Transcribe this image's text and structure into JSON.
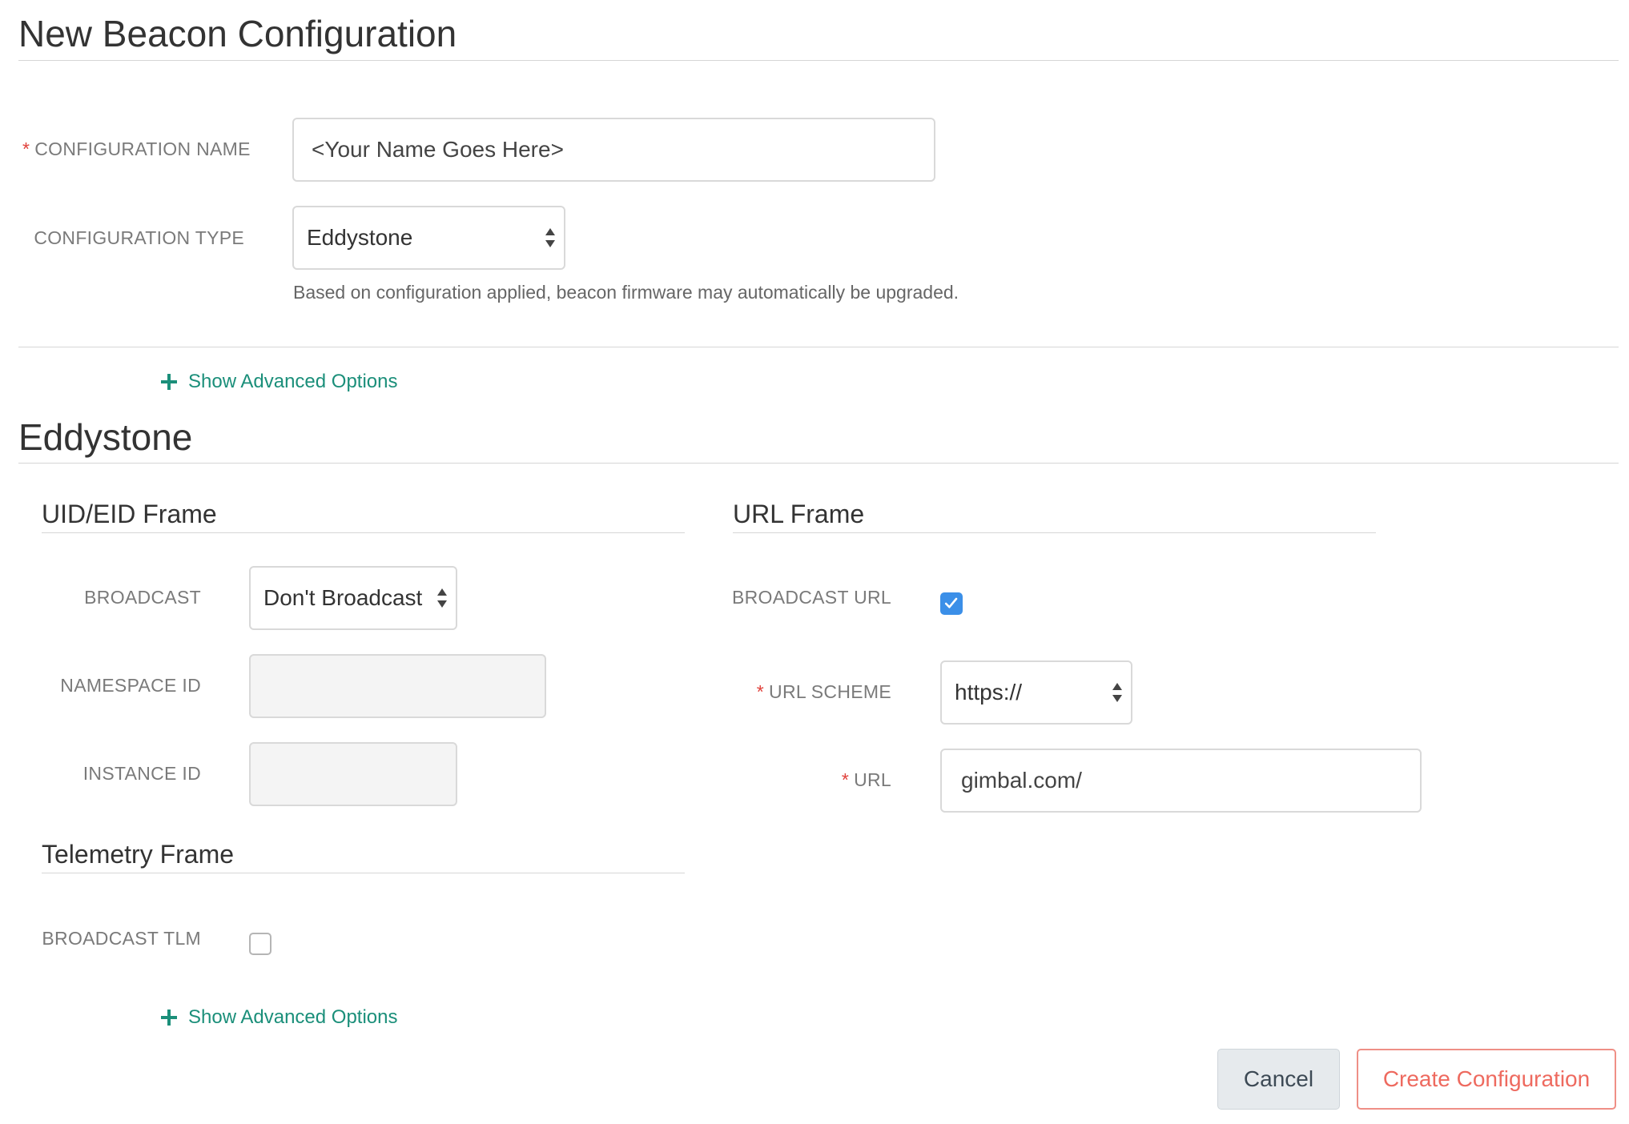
{
  "header": {
    "title": "New Beacon Configuration"
  },
  "form": {
    "required_marker": "*",
    "name_label": "CONFIGURATION NAME",
    "name_value": "<Your Name Goes Here>",
    "type_label": "CONFIGURATION TYPE",
    "type_value": "Eddystone",
    "hint": "Based on configuration applied, beacon firmware may automatically be upgraded.",
    "advanced_link": "Show Advanced Options"
  },
  "eddystone": {
    "title": "Eddystone",
    "uid_frame": {
      "title": "UID/EID Frame",
      "broadcast_label": "BROADCAST",
      "broadcast_value": "Don't Broadcast",
      "namespace_label": "NAMESPACE ID",
      "namespace_value": "",
      "instance_label": "INSTANCE ID",
      "instance_value": ""
    },
    "url_frame": {
      "title": "URL Frame",
      "broadcast_url_label": "BROADCAST URL",
      "broadcast_url_checked": true,
      "scheme_label": "URL SCHEME",
      "scheme_value": "https://",
      "url_label": "URL",
      "url_value": "gimbal.com/"
    },
    "telemetry_frame": {
      "title": "Telemetry Frame",
      "broadcast_tlm_label": "BROADCAST TLM",
      "broadcast_tlm_checked": false
    },
    "advanced_link": "Show Advanced Options"
  },
  "actions": {
    "cancel_label": "Cancel",
    "create_label": "Create Configuration"
  },
  "colors": {
    "accent": "#1b8f7a",
    "required": "#e0403a",
    "checkbox_checked": "#3b8fe8",
    "create_button": "#ee6a5f"
  },
  "icons": {
    "plus": "plus-icon",
    "select_arrows": "sort-arrows-icon",
    "check": "checkmark-icon"
  }
}
